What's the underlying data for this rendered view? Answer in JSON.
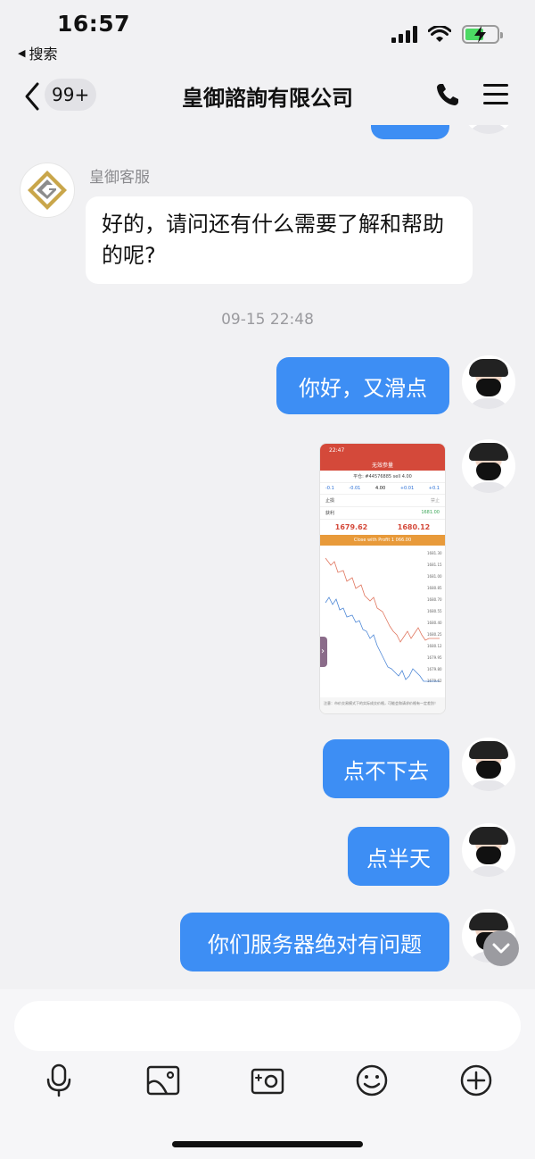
{
  "status_bar": {
    "time": "16:57",
    "back_app": "搜索"
  },
  "nav": {
    "unread_badge": "99+",
    "title": "皇御諮詢有限公司"
  },
  "chat": {
    "incoming": {
      "sender": "皇御客服",
      "text": "好的，请问还有什么需要了解和帮助的呢?"
    },
    "timestamp": "09-15 22:48",
    "outgoing": [
      {
        "text": "你好，又滑点"
      },
      {
        "text": "点不下去"
      },
      {
        "text": "点半天"
      },
      {
        "text": "你们服务器绝对有问题"
      }
    ],
    "screenshot": {
      "time": "22:47",
      "title": "无效参量",
      "order_line": "平仓: #44576885 sell 4.00",
      "steps": [
        "-0.1",
        "-0.01",
        "4.00",
        "+0.01",
        "+0.1"
      ],
      "stop_loss_label": "止损",
      "stop_loss_value": "禁止",
      "take_profit_label": "获利",
      "take_profit_value": "1681.00",
      "bid": "1679.62",
      "ask": "1680.12",
      "close_button": "Close with Profit 1 066.00",
      "price_ticks": [
        "1681.30",
        "1681.15",
        "1681.00",
        "1680.85",
        "1680.70",
        "1680.55",
        "1680.40",
        "1680.25",
        "1680.12",
        "1679.95",
        "1679.80",
        "1679.62"
      ],
      "footer": "注意：市价交易模式下的实际成交价格，可能会和请求价格有一定差别！"
    }
  },
  "input": {
    "placeholder": ""
  },
  "colors": {
    "bubble_blue": "#3d8ef4",
    "background": "#f1f1f3"
  }
}
